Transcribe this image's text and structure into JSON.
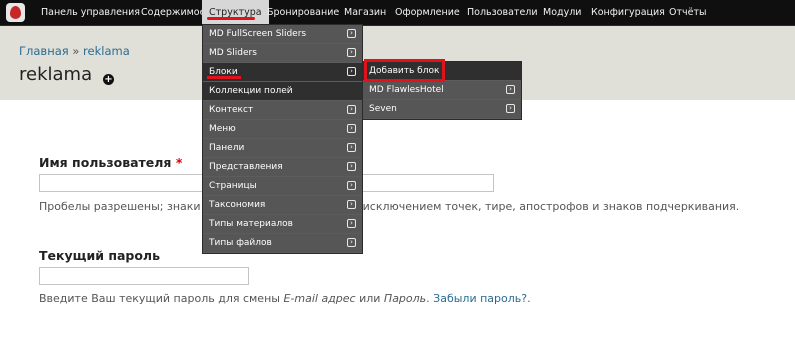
{
  "toolbar": {
    "items": [
      {
        "label": "Панель управления"
      },
      {
        "label": "Содержимое"
      },
      {
        "label": "Структура"
      },
      {
        "label": "Бронирование"
      },
      {
        "label": "Магазин"
      },
      {
        "label": "Оформление"
      },
      {
        "label": "Пользователи"
      },
      {
        "label": "Модули"
      },
      {
        "label": "Конфигурация"
      },
      {
        "label": "Отчёты"
      }
    ],
    "active": "Структура",
    "logo_icon": "drupal-drop-icon"
  },
  "breadcrumb": {
    "home": "Главная",
    "separator": "»",
    "current": "reklama"
  },
  "page": {
    "title": "reklama",
    "add_icon": "plus-circle-icon"
  },
  "form": {
    "username": {
      "label": "Имя пользователя",
      "required_mark": "*",
      "value": "",
      "description": "Пробелы разрешены; знаки пунктуации запрещены за исключением точек, тире, апострофов и знаков подчеркивания."
    },
    "password": {
      "label": "Текущий пароль",
      "value": "",
      "description_prefix": "Введите Ваш текущий пароль для смены ",
      "email_em": "E-mail адрес",
      "or": " или ",
      "password_em": "Пароль",
      "dot_space": ". ",
      "forgot_link": "Забыли пароль?",
      "end": "."
    }
  },
  "structure_menu": {
    "items": [
      {
        "label": "MD FullScreen Sliders",
        "has_sub": true
      },
      {
        "label": "MD Sliders",
        "has_sub": true
      },
      {
        "label": "Блоки",
        "has_sub": true
      },
      {
        "label": "Коллекции полей",
        "has_sub": false
      },
      {
        "label": "Контекст",
        "has_sub": true
      },
      {
        "label": "Меню",
        "has_sub": true
      },
      {
        "label": "Панели",
        "has_sub": true
      },
      {
        "label": "Представления",
        "has_sub": true
      },
      {
        "label": "Страницы",
        "has_sub": true
      },
      {
        "label": "Таксономия",
        "has_sub": true
      },
      {
        "label": "Типы материалов",
        "has_sub": true
      },
      {
        "label": "Типы файлов",
        "has_sub": true
      }
    ]
  },
  "blocks_submenu": {
    "items": [
      {
        "label": "Добавить блок",
        "has_sub": false
      },
      {
        "label": "MD FlawlesHotel",
        "has_sub": true
      },
      {
        "label": "Seven",
        "has_sub": true
      }
    ]
  },
  "icons": {
    "submenu_arrow": "arrow-right-icon"
  },
  "colors": {
    "toolbar_bg": "#0f0f0f",
    "header_bg": "#e1e0d8",
    "menu_bg": "#565656",
    "highlight": "#e0121c",
    "link": "#2a6c92"
  }
}
